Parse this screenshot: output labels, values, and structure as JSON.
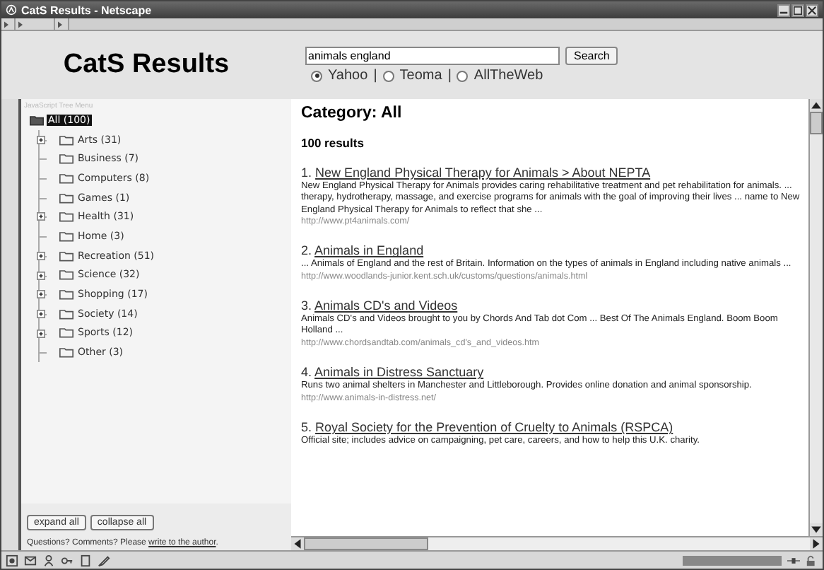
{
  "window": {
    "title": "CatS Results - Netscape"
  },
  "header": {
    "title": "CatS Results",
    "search": {
      "value": "animals england",
      "button": "Search"
    },
    "engines": [
      {
        "label": "Yahoo",
        "selected": true
      },
      {
        "label": "Teoma",
        "selected": false
      },
      {
        "label": "AllTheWeb",
        "selected": false
      }
    ],
    "separator": "|"
  },
  "sidebar": {
    "caption": "JavaScript Tree Menu",
    "root": {
      "label": "All (100)",
      "selected": true,
      "children": [
        {
          "label": "Arts (31)",
          "expandable": true,
          "selected": false
        },
        {
          "label": "Business (7)",
          "expandable": false,
          "selected": false
        },
        {
          "label": "Computers (8)",
          "expandable": false,
          "selected": false
        },
        {
          "label": "Games (1)",
          "expandable": false,
          "selected": false
        },
        {
          "label": "Health (31)",
          "expandable": true,
          "selected": false
        },
        {
          "label": "Home (3)",
          "expandable": false,
          "selected": false
        },
        {
          "label": "Recreation (51)",
          "expandable": true,
          "selected": false
        },
        {
          "label": "Science (32)",
          "expandable": true,
          "selected": false
        },
        {
          "label": "Shopping (17)",
          "expandable": true,
          "selected": false
        },
        {
          "label": "Society (14)",
          "expandable": true,
          "selected": false
        },
        {
          "label": "Sports (12)",
          "expandable": true,
          "selected": false
        },
        {
          "label": "Other (3)",
          "expandable": false,
          "selected": false
        }
      ]
    },
    "buttons": [
      "expand all",
      "collapse all"
    ],
    "footer": {
      "text": "Questions? Comments? Please",
      "link": "write to the author",
      "end": "."
    }
  },
  "content": {
    "heading": "Category: All",
    "count": "100 results",
    "results": [
      {
        "number": "1.",
        "title": "New England Physical Therapy for Animals > About NEPTA",
        "snippet": "New England Physical Therapy for Animals provides caring rehabilitative treatment and pet rehabilitation for animals. ... therapy, hydrotherapy, massage, and exercise programs for animals with the goal of improving their lives ... name to New England Physical Therapy for Animals to reflect that she ...",
        "url": "http://www.pt4animals.com/"
      },
      {
        "number": "2.",
        "title": "Animals in England",
        "snippet": "... Animals of England and the rest of Britain. Information on the types of animals in England including native animals ...",
        "url": "http://www.woodlands-junior.kent.sch.uk/customs/questions/animals.html"
      },
      {
        "number": "3.",
        "title": "Animals CD's and Videos",
        "snippet": "Animals CD's and Videos brought to you by Chords And Tab dot Com ... Best Of The Animals England. Boom Boom Holland ...",
        "url": "http://www.chordsandtab.com/animals_cd's_and_videos.htm"
      },
      {
        "number": "4.",
        "title": "Animals in Distress Sanctuary",
        "snippet": "Runs two animal shelters in Manchester and Littleborough. Provides online donation and animal sponsorship.",
        "url": "http://www.animals-in-distress.net/"
      },
      {
        "number": "5.",
        "title": "Royal Society for the Prevention of Cruelty to Animals (RSPCA)",
        "snippet": "Official site; includes advice on campaigning, pet care, careers, and how to help this U.K. charity."
      }
    ]
  }
}
